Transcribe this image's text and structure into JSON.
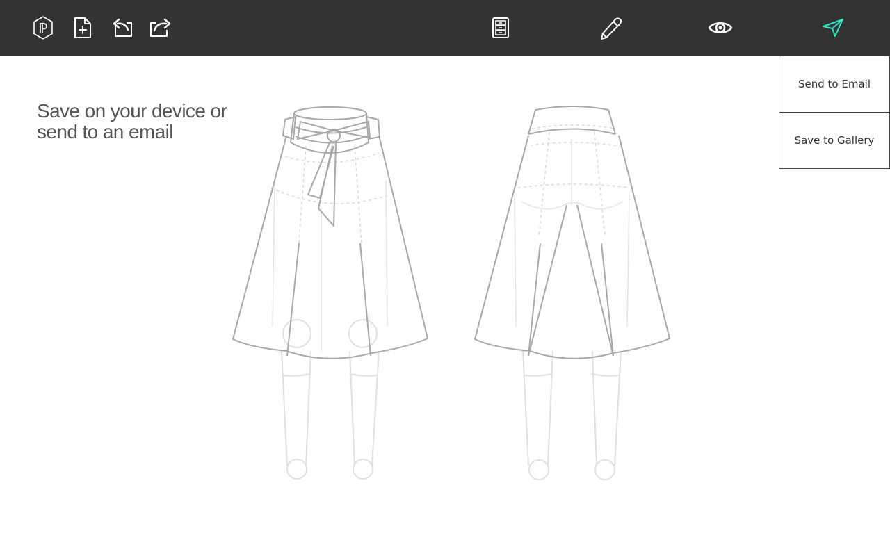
{
  "toolbar": {
    "left_icons": [
      "logo-hexagon-icon",
      "new-file-icon",
      "undo-icon",
      "share-icon"
    ],
    "right_icons": [
      "cabinet-icon",
      "pencil-icon",
      "eye-icon",
      "send-icon"
    ],
    "icon_color": "#ffffff",
    "active_icon_color": "#2ee8c4",
    "background": "#333333"
  },
  "headline": {
    "line1": "Save on your device or",
    "line2": "send to an email"
  },
  "send_menu": {
    "items": [
      {
        "label": "Send to Email"
      },
      {
        "label": "Save to Gallery"
      }
    ]
  },
  "canvas": {
    "views": [
      "front-view",
      "back-view"
    ],
    "garment": "skirt"
  }
}
